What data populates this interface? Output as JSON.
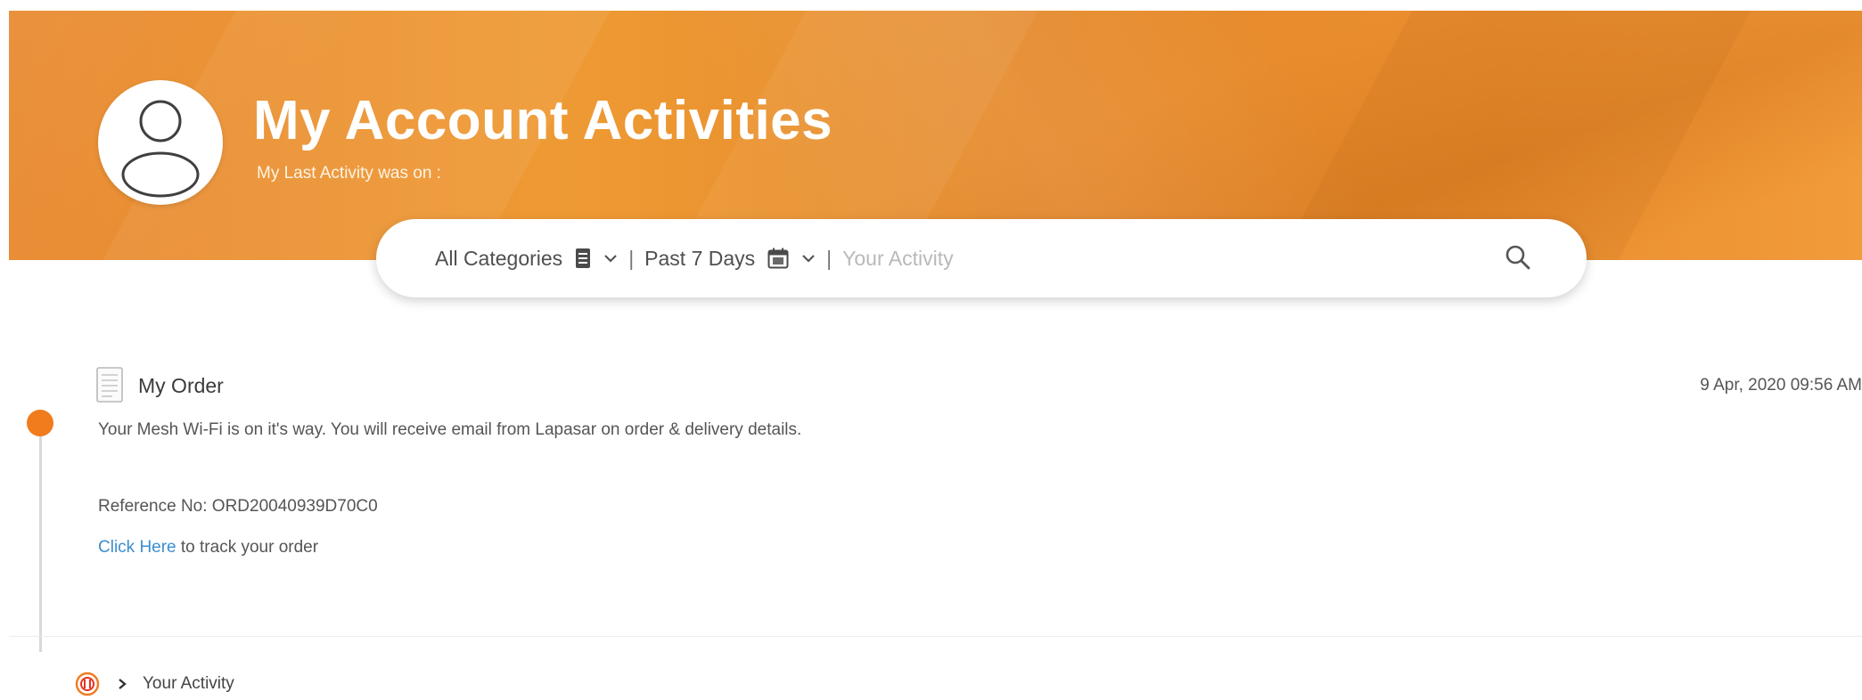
{
  "header": {
    "title": "My Account Activities",
    "subtitle": "My Last Activity was on :"
  },
  "search": {
    "category_label": "All Categories",
    "period_label": "Past 7 Days",
    "separator": "|",
    "placeholder": "Your Activity"
  },
  "activity": {
    "title": "My Order",
    "datetime": "9 Apr, 2020 09:56 AM",
    "description": "Your Mesh Wi-Fi is on it's way. You will receive email from Lapasar on order & delivery details.",
    "reference": "Reference No: ORD20040939D70C0",
    "track_link": "Click Here",
    "track_text": " to track your order"
  },
  "breadcrumb": {
    "home_icon": "home-logo-icon",
    "current": "Your Activity"
  },
  "colors": {
    "banner": "#ea8e2f",
    "accent": "#f07c1e",
    "link": "#3b8ed0"
  }
}
